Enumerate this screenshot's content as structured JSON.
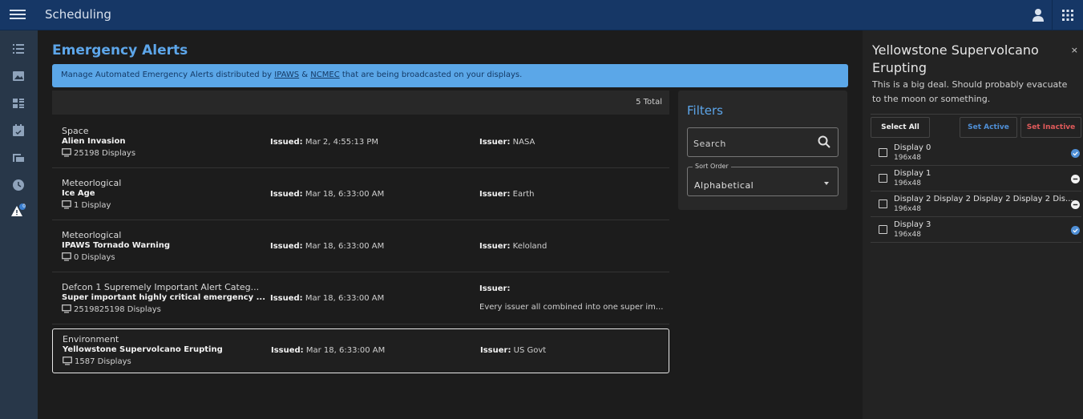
{
  "header": {
    "title": "Scheduling"
  },
  "page": {
    "title": "Emergency Alerts",
    "banner": {
      "prefix": "Manage Automated Emergency Alerts distributed by ",
      "link1": "IPAWS",
      "mid": " & ",
      "link2": "NCMEC",
      "suffix": " that are being broadcasted on your displays."
    },
    "total": "5 Total"
  },
  "rail": {
    "badge": "0"
  },
  "labels": {
    "issued": "Issued:",
    "issuer": "Issuer:"
  },
  "alerts": [
    {
      "category": "Space",
      "name": "Alien Invasion",
      "displays": "25198 Displays",
      "issued": "Mar 2, 4:55:13 PM",
      "issuer": "NASA"
    },
    {
      "category": "Meteorlogical",
      "name": "Ice Age",
      "displays": "1 Display",
      "issued": "Mar 18, 6:33:00 AM",
      "issuer": "Earth"
    },
    {
      "category": "Meteorlogical",
      "name": "IPAWS Tornado Warning",
      "displays": "0 Displays",
      "issued": "Mar 18, 6:33:00 AM",
      "issuer": "Keloland"
    },
    {
      "category": "Defcon 1 Supremely Important Alert Categ...",
      "name": "Super important highly critical emergency ...",
      "displays": "2519825198 Displays",
      "issued": "Mar 18, 6:33:00 AM",
      "issuer": "",
      "issuer_line2": "Every issuer all combined into one super im..."
    },
    {
      "category": "Environment",
      "name": "Yellowstone Supervolcano Erupting",
      "displays": "1587 Displays",
      "issued": "Mar 18, 6:33:00 AM",
      "issuer": "US Govt"
    }
  ],
  "filters": {
    "title": "Filters",
    "search_placeholder": "Search",
    "sort_label": "Sort Order",
    "sort_value": "Alphabetical"
  },
  "detail": {
    "title": "Yellowstone Supervolcano Erupting",
    "close": "×",
    "description": "This is a big deal. Should probably evacuate to the moon or something.",
    "select_all": "Select All",
    "set_active": "Set Active",
    "set_inactive": "Set Inactive",
    "displays": [
      {
        "name": "Display 0",
        "size": "196x48",
        "status": "active"
      },
      {
        "name": "Display 1",
        "size": "196x48",
        "status": "inactive"
      },
      {
        "name": "Display 2 Display 2 Display 2 Display 2 Dis...",
        "size": "196x48",
        "status": "inactive"
      },
      {
        "name": "Display 3",
        "size": "196x48",
        "status": "active"
      }
    ]
  },
  "colors": {
    "accent": "#5da6ea",
    "banner": "#5ba7e8",
    "topbar": "#163766",
    "active": "#4f8fd6",
    "inactive": "#e05a5a"
  }
}
